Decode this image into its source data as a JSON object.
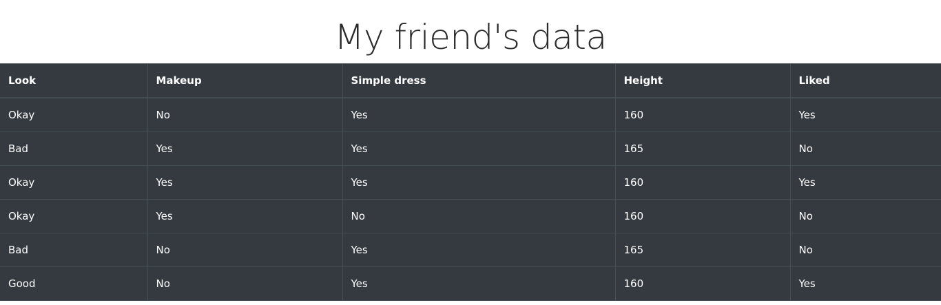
{
  "page": {
    "title": "My friend's data"
  },
  "table": {
    "headers": [
      "Look",
      "Makeup",
      "Simple dress",
      "Height",
      "Liked"
    ],
    "rows": [
      [
        "Okay",
        "No",
        "Yes",
        "160",
        "Yes"
      ],
      [
        "Bad",
        "Yes",
        "Yes",
        "165",
        "No"
      ],
      [
        "Okay",
        "Yes",
        "Yes",
        "160",
        "Yes"
      ],
      [
        "Okay",
        "Yes",
        "No",
        "160",
        "No"
      ],
      [
        "Bad",
        "No",
        "Yes",
        "165",
        "No"
      ],
      [
        "Good",
        "No",
        "Yes",
        "160",
        "Yes"
      ]
    ]
  },
  "colors": {
    "table_background": "#343a40",
    "table_border": "#454d55",
    "table_text": "#ffffff",
    "title_text": "#2b2b2b"
  }
}
